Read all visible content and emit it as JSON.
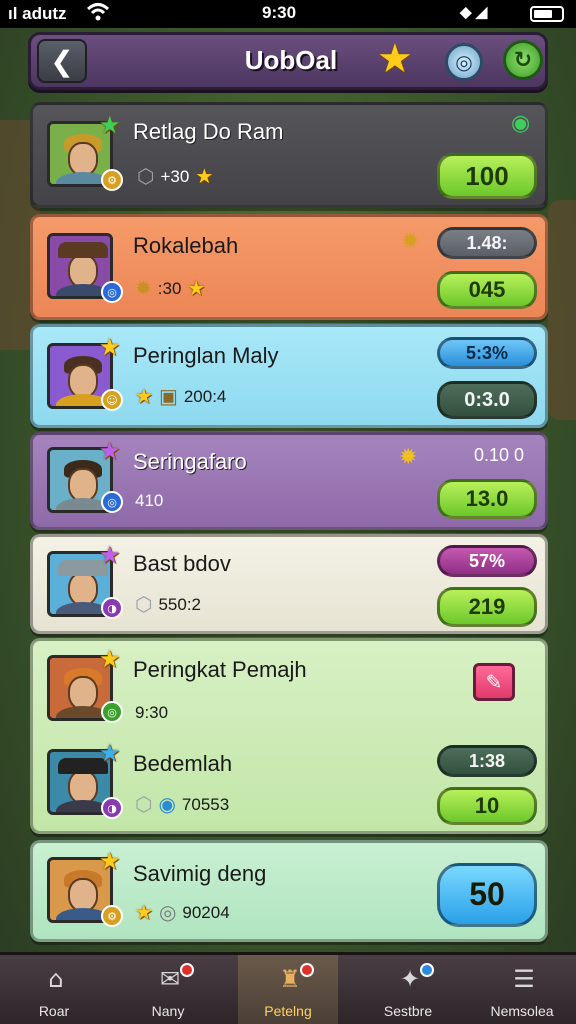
{
  "status_bar": {
    "carrier": "ıl adutz",
    "time": "9:30"
  },
  "header": {
    "title": "UobOal"
  },
  "players": [
    {
      "name": "Retlag Do Ram",
      "stat": "+30",
      "pill_value": "100"
    },
    {
      "name": "Rokalebah",
      "stat": ":30",
      "rate": "1.48:",
      "pill_value": "045"
    },
    {
      "name": "Peringlan Maly",
      "stat": "200:4",
      "rate": "5:3%",
      "pill_value": "0:3.0"
    },
    {
      "name": "Seringafaro",
      "stat": "410",
      "rate": "0.10 0",
      "pill_value": "13.0"
    },
    {
      "name": "Bast bdov",
      "stat": "550:2",
      "rate": "57%",
      "pill_value": "219"
    },
    {
      "name": "Peringkat Pemajh",
      "stat": "9:30"
    },
    {
      "name": "Bedemlah",
      "stat": "70553",
      "rate": "1:38",
      "pill_value": "10"
    },
    {
      "name": "Savimig deng",
      "stat": "90204",
      "pill_value": "50"
    }
  ],
  "nav": [
    {
      "label": "Roar",
      "icon": "home-icon"
    },
    {
      "label": "Nany",
      "icon": "chat-icon"
    },
    {
      "label": "Petelng",
      "icon": "ranking-icon"
    },
    {
      "label": "Sestbre",
      "icon": "store-icon"
    },
    {
      "label": "Nemsolea",
      "icon": "menu-icon"
    }
  ]
}
